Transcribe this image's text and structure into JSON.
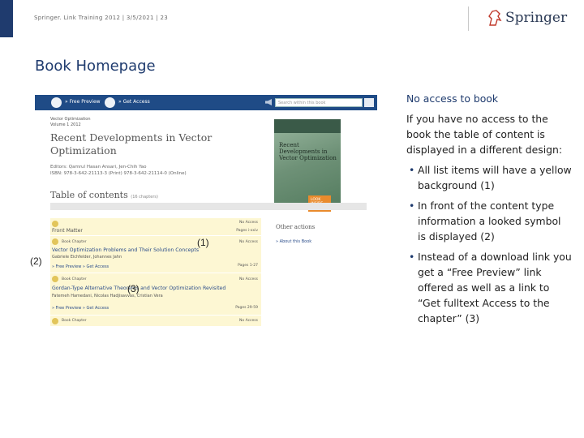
{
  "header": {
    "footer_text": "Springer. Link Training 2012 | 3/5/2021 | 23",
    "brand": "Springer",
    "brand_icon": "springer-horse-icon"
  },
  "slide_title": "Book Homepage",
  "screenshot": {
    "topbar": {
      "free_preview_label": "» Free Preview",
      "get_access_label": "» Get Access",
      "search_placeholder": "Search within this book"
    },
    "series": "Vector Optimization",
    "volume": "Volume 1 2012",
    "book_title": "Recent Developments in Vector Optimization",
    "editors": "Editors: Qamrul Hasan Ansari, Jen-Chih Yao",
    "isbn": "ISBN: 978-3-642-21113-3 (Print) 978-3-642-21114-0 (Online)",
    "toc_heading": "Table of contents",
    "toc_subnote": "(16 chapters)",
    "cover": {
      "title": "Recent Developments in Vector Optimization",
      "badge": "LOOK INSIDE",
      "brand": "Springer"
    },
    "rows": [
      {
        "title": "Front Matter",
        "right_top": "No Access",
        "right_bottom": "Pages i-xxiv",
        "links": ""
      },
      {
        "type": "Book Chapter",
        "title": "Vector Optimization Problems and Their Solution Concepts",
        "authors": "Gabriele Eichfelder, Johannes Jahn",
        "right_top": "No Access",
        "right_bottom": "Pages 1-27",
        "links": "» Free Preview    » Get Access"
      },
      {
        "type": "Book Chapter",
        "title": "Gordan-Type Alternative Theorems and Vector Optimization Revisited",
        "authors": "Fatemeh Hamedani, Nicolas Hadjisavvas, Cristian Vera",
        "right_top": "No Access",
        "right_bottom": "Pages 29-59",
        "links": "» Free Preview    » Get Access"
      },
      {
        "type": "Book Chapter",
        "title": "",
        "authors": "",
        "right_top": "No Access",
        "right_bottom": "",
        "links": ""
      }
    ],
    "other_actions": "Other actions",
    "about_link": "» About this Book"
  },
  "annotations": {
    "a1": "(1)",
    "a2": "(2)",
    "a3": "(3)"
  },
  "notes": {
    "title": "No access to book",
    "intro": "If you have no access to the book the table of content is displayed in a different design:",
    "bullets": [
      "All list items will have a yellow background (1)",
      "In front of the content type information a looked symbol is displayed (2)",
      "Instead of a download link you get a “Free Preview” link offered as well as a link to “Get fulltext Access to the chapter” (3)"
    ]
  },
  "colors": {
    "brand_blue": "#1f3b6e",
    "row_yellow": "#fdf7d3",
    "link_blue": "#2b4d8a"
  }
}
